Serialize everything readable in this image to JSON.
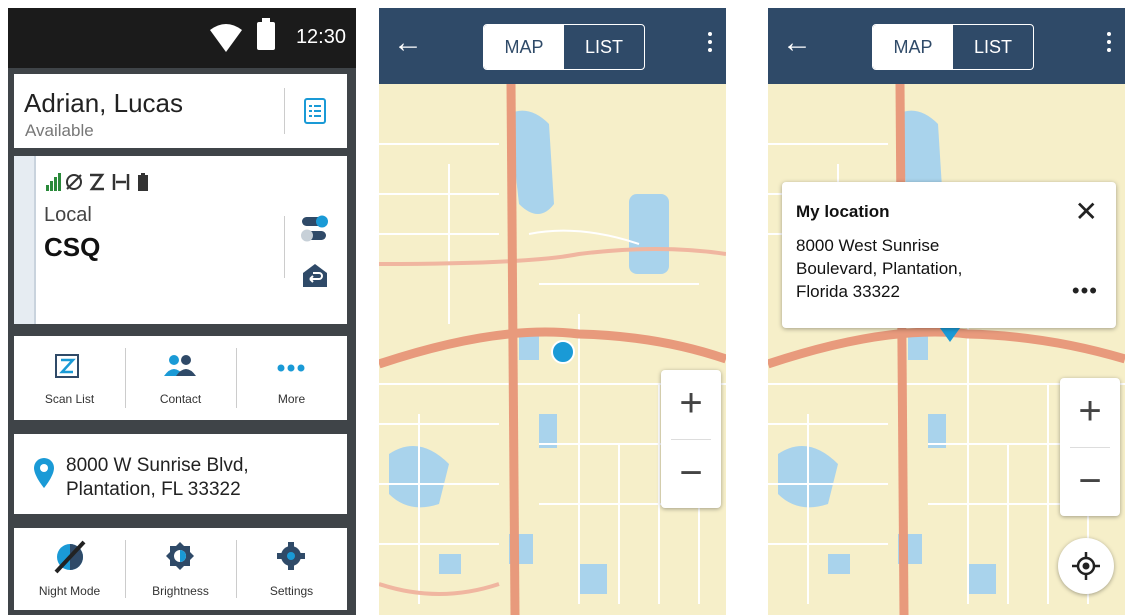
{
  "status_bar": {
    "time": "12:30"
  },
  "contact": {
    "name": "Adrian, Lucas",
    "status": "Available"
  },
  "channel": {
    "zone": "Local",
    "name": "CSQ"
  },
  "shortcuts": [
    {
      "label": "Scan List"
    },
    {
      "label": "Contact"
    },
    {
      "label": "More"
    }
  ],
  "location_card": {
    "line1": "8000 W Sunrise Blvd,",
    "line2": "Plantation, FL 33322"
  },
  "controls": [
    {
      "label": "Night Mode"
    },
    {
      "label": "Brightness"
    },
    {
      "label": "Settings"
    }
  ],
  "map_view": {
    "tab_map": "MAP",
    "tab_list": "LIST",
    "zoom_in": "+",
    "zoom_out": "−"
  },
  "popup": {
    "title": "My location",
    "address_line1": "8000 West Sunrise",
    "address_line2": "Boulevard, Plantation,",
    "address_line3": "Florida 33322",
    "more": "•••"
  },
  "colors": {
    "appbar": "#2f4a68",
    "accent_blue": "#1a9ad6",
    "map_land": "#f6efc9",
    "road_major": "#e89a7c"
  }
}
